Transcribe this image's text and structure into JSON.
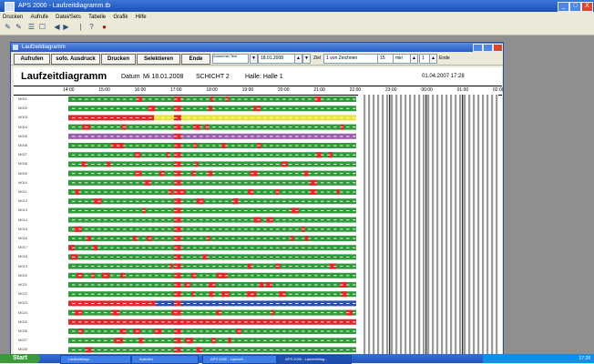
{
  "app": {
    "title": "APS 2000 - Laufzeitdiagramm.tb",
    "menu": [
      "Drucken",
      "Aufrufe",
      "Datei/Sets",
      "Tabelle",
      "Grafik",
      "Hilfe"
    ],
    "window_buttons": [
      "_",
      "□",
      "X"
    ]
  },
  "window": {
    "title": "Laufzeitdiagramm",
    "buttons": [
      "_",
      "□",
      "X"
    ]
  },
  "toolbar": {
    "buttons": [
      "Aufrufen",
      "sofo. Ausdruck",
      "Drucken",
      "Selektieren",
      "Ende"
    ],
    "zoom_label": "Zoom/min Text",
    "date_value": "18.01.2008",
    "spin_up": "▲",
    "spin_down": "▼",
    "filter_label": "Ziel",
    "interval_label": "1 von Zeichnen",
    "interval_value": "15",
    "unit_label": "min",
    "page_label": "1",
    "extra_label": "Ende"
  },
  "sheet": {
    "title": "Laufzeitdiagramm",
    "date_label": "Datum",
    "date_value": "Mi 18.01.2008",
    "shift": "SCHICHT 2",
    "hall": "Halle: Halle 1",
    "printed": "01.04.2007  17:28"
  },
  "axis": {
    "ticks": [
      "14:00",
      "15:00",
      "16:00",
      "17:00",
      "18:00",
      "19:00",
      "20:00",
      "21:00",
      "22:00",
      "23:00",
      "00:00",
      "01:00",
      "02:00"
    ]
  },
  "rows": {
    "labels": [
      "M001",
      "M002",
      "M003",
      "M004",
      "M005",
      "M006",
      "M007",
      "M008",
      "M009",
      "M010",
      "M011",
      "M012",
      "M013",
      "M014",
      "M015",
      "M016",
      "M017",
      "M018",
      "M019",
      "M020",
      "M021",
      "M022",
      "M023",
      "M024",
      "M025",
      "M026",
      "M027",
      "M028"
    ]
  },
  "colors": {
    "running": "#2f9a3a",
    "stopped": "#e0282c",
    "setup": "#e8e43a",
    "maintenance": "#9b5ea8",
    "idle": "#2a4fb0",
    "future": "#8f8f8f"
  },
  "taskbar": {
    "start": "Start",
    "tasks": [
      "Laufzeitdiagr...",
      "Aufrufen",
      "APS 2000 - Laufzeit...",
      "APS 2000 - Laufzeitdiag..."
    ],
    "clock": "17:28"
  }
}
